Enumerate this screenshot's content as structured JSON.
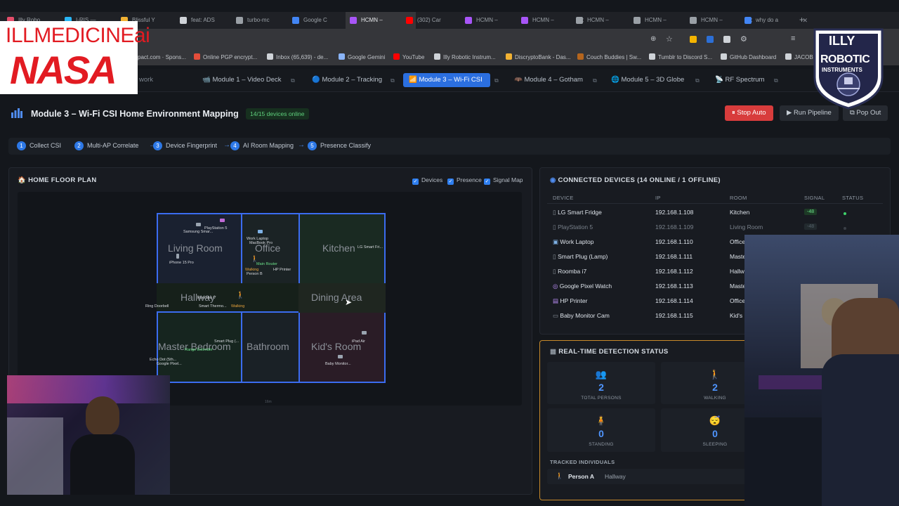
{
  "browser": {
    "tabs": [
      {
        "label": "Illy Robo",
        "color": "#e44d6a"
      },
      {
        "label": "I-RIS — ",
        "color": "#29b6f6"
      },
      {
        "label": "Blissful Y",
        "color": "#f2b233"
      },
      {
        "label": "feat: ADS",
        "color": "#cfd3d8"
      },
      {
        "label": "turbo-mc",
        "color": "#9aa0a6"
      },
      {
        "label": "Google C",
        "color": "#4285f4"
      },
      {
        "label": "HCMN –",
        "color": "#a855f7",
        "active": true
      },
      {
        "label": "(302) Car",
        "color": "#ff0000"
      },
      {
        "label": "HCMN –",
        "color": "#a855f7"
      },
      {
        "label": "HCMN –",
        "color": "#a855f7"
      },
      {
        "label": "HCMN –",
        "color": "#9aa0a6"
      },
      {
        "label": "HCMN –",
        "color": "#9aa0a6"
      },
      {
        "label": "HCMN –",
        "color": "#9aa0a6"
      },
      {
        "label": "why do a",
        "color": "#4285f4"
      }
    ],
    "bookmarks": [
      {
        "label": "pact.com · Spons...",
        "color": "#8a8f96"
      },
      {
        "label": "Online PGP encrypt...",
        "color": "#e44d3a"
      },
      {
        "label": "Inbox (65,639) - de...",
        "color": "#cfd3d8"
      },
      {
        "label": "Google Gemini",
        "color": "#8ab4f8"
      },
      {
        "label": "YouTube",
        "color": "#ff0000"
      },
      {
        "label": "Illy Robotic Instrum...",
        "color": "#cfd3d8"
      },
      {
        "label": "DiscryptoBank - Das...",
        "color": "#f2b233"
      },
      {
        "label": "Couch Buddies | Sw...",
        "color": "#b5651d"
      },
      {
        "label": "Tumblr to Discord S...",
        "color": "#cfd3d8"
      },
      {
        "label": "GitHub Dashboard",
        "color": "#cfd3d8"
      },
      {
        "label": "JACOB",
        "color": "#cfd3d8"
      }
    ]
  },
  "overlay": {
    "brand_top": "ILLMEDICINEai",
    "brand_nasa": "NASA",
    "illy_title": "ILLY",
    "illy_sub": "ROBOTIC",
    "illy_sub2": "INSTRUMENTS"
  },
  "modules": {
    "partial_label": "work",
    "items": [
      {
        "label": "Module 1 – Video Deck",
        "icon": "📹"
      },
      {
        "label": "Module 2 – Tracking",
        "icon": "🔵"
      },
      {
        "label": "Module 3 – Wi-Fi CSI",
        "icon": "📶",
        "active": true
      },
      {
        "label": "Module 4 – Gotham",
        "icon": "🦇"
      },
      {
        "label": "Module 5 – 3D Globe",
        "icon": "🌐"
      },
      {
        "label": "RF Spectrum",
        "icon": "📡"
      }
    ]
  },
  "header": {
    "title": "Module 3 – Wi-Fi CSI Home Environment Mapping",
    "online_badge": "14/15 devices online",
    "stop_label": "⏸ Stop Auto",
    "run_label": "▶ Run Pipeline",
    "popout_label": "⧉ Pop Out"
  },
  "pipeline": [
    {
      "num": "1",
      "label": "Collect CSI"
    },
    {
      "num": "2",
      "label": "Multi-AP Correlate"
    },
    {
      "num": "3",
      "label": "Device Fingerprint"
    },
    {
      "num": "4",
      "label": "AI Room Mapping"
    },
    {
      "num": "5",
      "label": "Presence Classify"
    }
  ],
  "floorplan": {
    "title": "HOME FLOOR PLAN",
    "toggles": [
      "Devices",
      "Presence",
      "Signal Map"
    ],
    "rooms": {
      "living": "Living Room",
      "office": "Office",
      "kitchen": "Kitchen",
      "hallway": "Hallway",
      "dining": "Dining Area",
      "master": "Master Bedroom",
      "bathroom": "Bathroom",
      "kids": "Kid's Room"
    },
    "devices": {
      "samsung": "Samsung Smar...",
      "ps5": "PlayStation 5",
      "iphone": "iPhone 15 Pro",
      "work_laptop": "Work Laptop",
      "macbook": "MacBook Pro",
      "main_router": "Main Router",
      "hp_printer": "HP Printer",
      "walking": "Walking",
      "person_b": "Person B",
      "lg_fridge": "LG Smart Fri...",
      "roomba": "Roomba i7",
      "ring": "Ring Doorbell",
      "smart_thermo": "Smart Thermo...",
      "hall_walking": "Walking",
      "smart_plug": "Smart Plug (...",
      "range_ext": "Range Extender",
      "echo": "Echo Dot (5th...",
      "google_pixel": "Google Pixel...",
      "ipad": "iPad Air",
      "baby_monitor": "Baby Monitor...",
      "scale": "16m"
    }
  },
  "devices_panel": {
    "title": "CONNECTED DEVICES (14 ONLINE / 1 OFFLINE)",
    "columns": [
      "DEVICE",
      "IP",
      "ROOM",
      "SIGNAL",
      "STATUS"
    ],
    "rows": [
      {
        "name": "LG Smart Fridge",
        "ip": "192.168.1.108",
        "room": "Kitchen",
        "signal": "-48",
        "online": true
      },
      {
        "name": "PlayStation 5",
        "ip": "192.168.1.109",
        "room": "Living Room",
        "signal": "-48",
        "online": false
      },
      {
        "name": "Work Laptop",
        "ip": "192.168.1.110",
        "room": "Office",
        "signal": "",
        "online": true
      },
      {
        "name": "Smart Plug (Lamp)",
        "ip": "192.168.1.111",
        "room": "Maste",
        "signal": "",
        "online": true
      },
      {
        "name": "Roomba i7",
        "ip": "192.168.1.112",
        "room": "Hallwa",
        "signal": "",
        "online": true
      },
      {
        "name": "Google Pixel Watch",
        "ip": "192.168.1.113",
        "room": "Maste",
        "signal": "",
        "online": true
      },
      {
        "name": "HP Printer",
        "ip": "192.168.1.114",
        "room": "Office",
        "signal": "",
        "online": true
      },
      {
        "name": "Baby Monitor Cam",
        "ip": "192.168.1.115",
        "room": "Kid's R",
        "signal": "",
        "online": true
      }
    ]
  },
  "detection": {
    "title": "REAL-TIME DETECTION STATUS",
    "stats": [
      {
        "value": "2",
        "label": "TOTAL PERSONS",
        "icon": "👥"
      },
      {
        "value": "2",
        "label": "WALKING",
        "icon": "🚶"
      },
      {
        "value": "0",
        "label": "STANDING",
        "icon": "🧍"
      },
      {
        "value": "0",
        "label": "SLEEPING",
        "icon": "😴"
      }
    ],
    "tracked_title": "TRACKED INDIVIDUALS",
    "tracked": [
      {
        "name": "Person A",
        "room": "Hallway"
      }
    ]
  }
}
